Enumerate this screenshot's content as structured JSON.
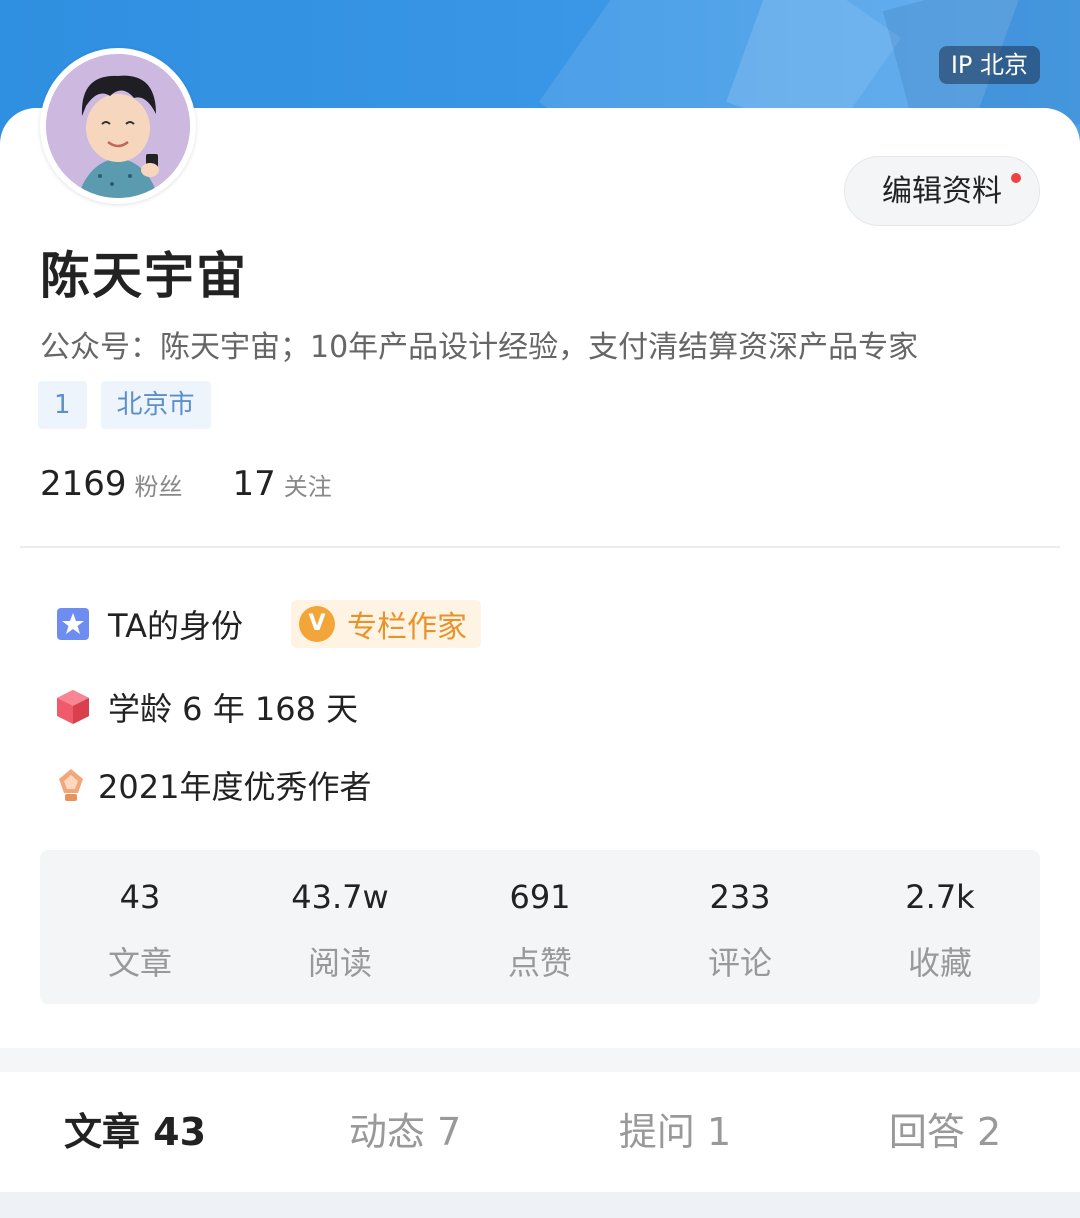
{
  "header": {
    "ip_location": "IP 北京"
  },
  "profile": {
    "name": "陈天宇宙",
    "edit_button": "编辑资料",
    "bio": "公众号：陈天宇宙；10年产品设计经验，支付清结算资深产品专家",
    "tags": [
      "1",
      "北京市"
    ],
    "followers": {
      "count": "2169",
      "label": "粉丝"
    },
    "following": {
      "count": "17",
      "label": "关注"
    }
  },
  "identity": {
    "title": "TA的身份",
    "badge": "专栏作家",
    "badge_icon": "V",
    "school_age": "学龄 6 年 168 天",
    "award": "2021年度优秀作者"
  },
  "stats": [
    {
      "value": "43",
      "label": "文章"
    },
    {
      "value": "43.7w",
      "label": "阅读"
    },
    {
      "value": "691",
      "label": "点赞"
    },
    {
      "value": "233",
      "label": "评论"
    },
    {
      "value": "2.7k",
      "label": "收藏"
    }
  ],
  "tabs": [
    {
      "label": "文章 43",
      "active": true
    },
    {
      "label": "动态 7"
    },
    {
      "label": "提问 1"
    },
    {
      "label": "回答 2"
    }
  ],
  "colors": {
    "accent": "#2f8fe0",
    "badge": "#e8932a",
    "notification_dot": "#f04142"
  }
}
